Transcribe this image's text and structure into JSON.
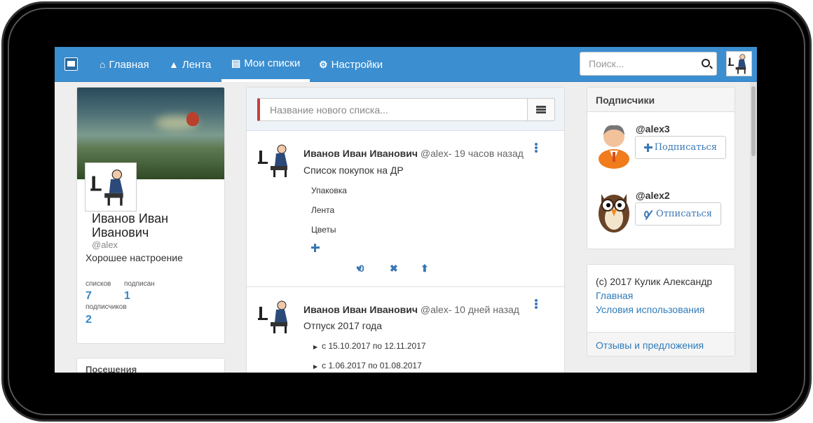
{
  "nav": {
    "items": [
      {
        "label": "Главная",
        "icon": "home-icon"
      },
      {
        "label": "Лента",
        "icon": "road-icon"
      },
      {
        "label": "Мои списки",
        "icon": "list-alt-icon",
        "active": true
      },
      {
        "label": "Настройки",
        "icon": "cog-icon"
      }
    ],
    "search_placeholder": "Поиск..."
  },
  "profile": {
    "name": "Иванов Иван Иванович",
    "handle": "@alex",
    "status": "Хорошее настроение",
    "stats": {
      "lists_label": "списков",
      "lists_value": "7",
      "following_label": "подписан",
      "following_value": "1",
      "followers_label": "подписчиков",
      "followers_value": "2"
    },
    "guestbook_title": "Посещения"
  },
  "new_list": {
    "placeholder": "Название нового списка..."
  },
  "posts": [
    {
      "author": "Иванов Иван Иванович",
      "meta": "@alex- 19 часов назад",
      "title": "Список покупок на ДР",
      "items": [
        "Упаковка",
        "Лента",
        "Цветы"
      ],
      "likes": "0"
    },
    {
      "author": "Иванов Иван Иванович",
      "meta": "@alex- 10 дней назад",
      "title": "Отпуск 2017 года",
      "items": [
        "с 15.10.2017 по 12.11.2017",
        "с 1.06.2017 по 01.08.2017"
      ]
    }
  ],
  "followers": {
    "title": "Подписчики",
    "list": [
      {
        "handle": "@alex3",
        "button": "Подписаться"
      },
      {
        "handle": "@alex2",
        "button": "Отписаться"
      }
    ]
  },
  "footer": {
    "copyright": "(c) 2017 Кулик Александр",
    "link_home": "Главная",
    "link_terms": "Условия использования",
    "link_feedback": "Отзывы и предложения"
  },
  "colors": {
    "navbar": "#3b8ed0",
    "link": "#2f7cbb",
    "accent_red": "#c53f3f"
  }
}
